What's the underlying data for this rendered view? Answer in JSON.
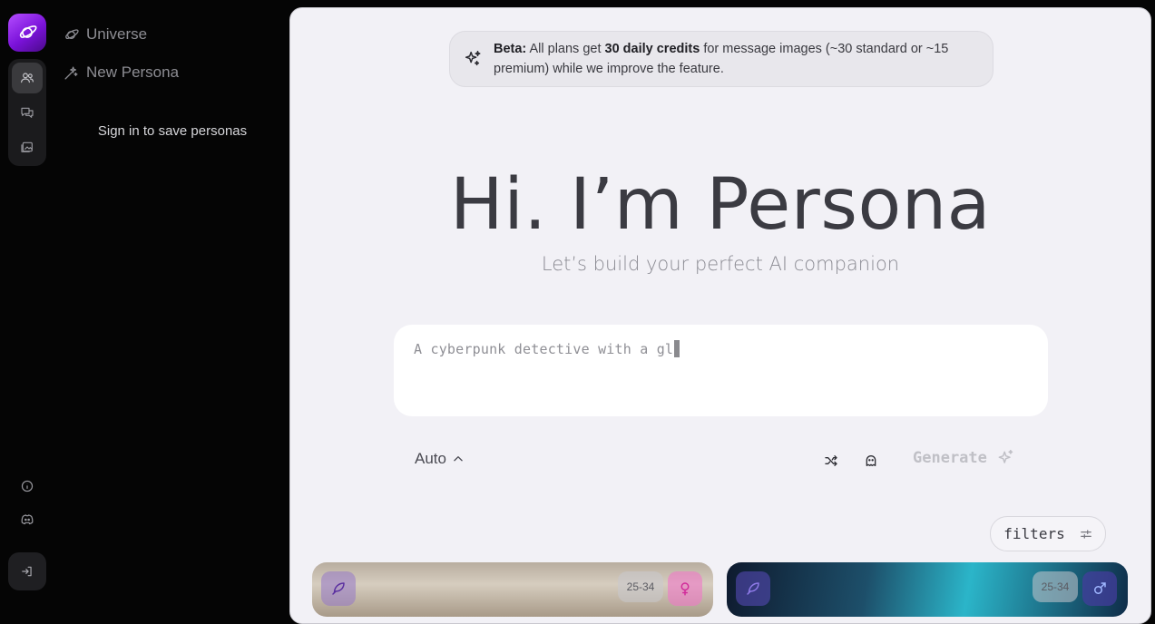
{
  "sidebar": {
    "nav": [
      {
        "label": "Universe",
        "icon": "planet-icon"
      },
      {
        "label": "New Persona",
        "icon": "magic-wand-icon"
      }
    ],
    "signin_prompt": "Sign in to save personas"
  },
  "banner": {
    "beta_label": "Beta:",
    "text_part1": " All plans get ",
    "credits": "30 daily credits",
    "text_part2": " for message images (~30 standard or ~15 premium) while we improve the feature."
  },
  "hero": {
    "title": "Hi. I’m Persona",
    "subtitle": "Let’s build your perfect AI companion"
  },
  "prompt": {
    "value": "A cyberpunk detective with a gl"
  },
  "controls": {
    "mode_label": "Auto",
    "generate_label": "Generate",
    "filters_label": "filters"
  },
  "cards": [
    {
      "age": "25-34"
    },
    {
      "age": "25-34"
    }
  ],
  "colors": {
    "accent": "#8a1fe6",
    "main_bg": "#f2f1f6",
    "sidebar_bg": "#050505"
  }
}
